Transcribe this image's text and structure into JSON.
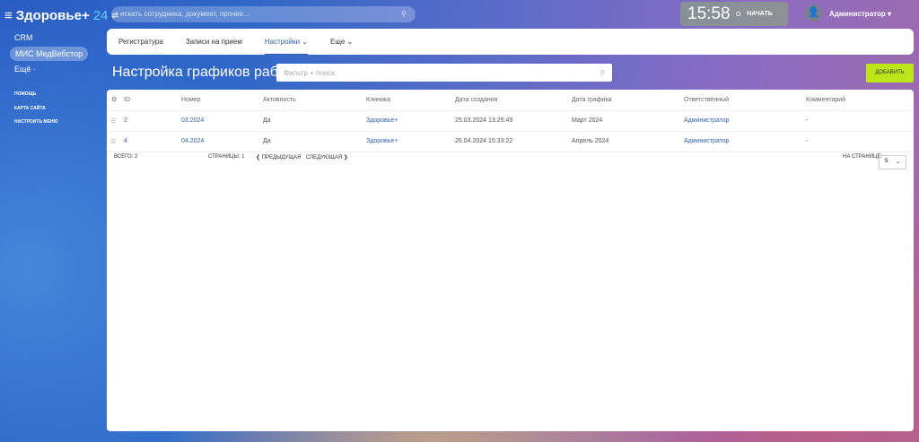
{
  "header": {
    "menu_icon": "hamburger-icon",
    "app_name": "Здоровье+",
    "app_num": "24",
    "search_placeholder": "искать сотрудника, документ, прочее...",
    "clock": "15:58",
    "start_label": "НАЧАТЬ",
    "user": "Администратор"
  },
  "sidebar": {
    "items": [
      "CRM",
      "МИС МедВебстор",
      "Ещё ·"
    ],
    "links": [
      "ПОМОЩЬ",
      "КАРТА САЙТА",
      "НАСТРОИТЬ МЕНЮ"
    ]
  },
  "nav": {
    "tabs": [
      "Регистратура",
      "Записи на прием",
      "Настройки ⌄",
      "Еще ⌄"
    ],
    "active": 2
  },
  "page": {
    "title": "Настройка графиков работы",
    "filter_placeholder": "Фильтр + поиск",
    "add_label": "ДОБАВИТЬ"
  },
  "table": {
    "headers": [
      "ID",
      "Номер",
      "Активность",
      "Клиника",
      "Дата создания",
      "Дата графика",
      "Ответственный",
      "Комментарий"
    ],
    "rows": [
      [
        "2",
        "03.2024",
        "Да",
        "Здоровье+",
        "25.03.2024 13:25:49",
        "Март 2024",
        "Администратор",
        "-"
      ],
      [
        "4",
        "04.2024",
        "Да",
        "Здоровье+",
        "26.04.2024 15:33:22",
        "Апрель 2024",
        "Администратор",
        "-"
      ]
    ]
  },
  "footer": {
    "total": "ВСЕГО: 2",
    "pages": "СТРАНИЦЫ: 1",
    "prev": "❮ ПРЕДЫДУЩАЯ",
    "next": "СЛЕДУЮЩАЯ ❯",
    "per_page_label": "НА СТРАНИЦЕ:",
    "per_page": "5"
  }
}
